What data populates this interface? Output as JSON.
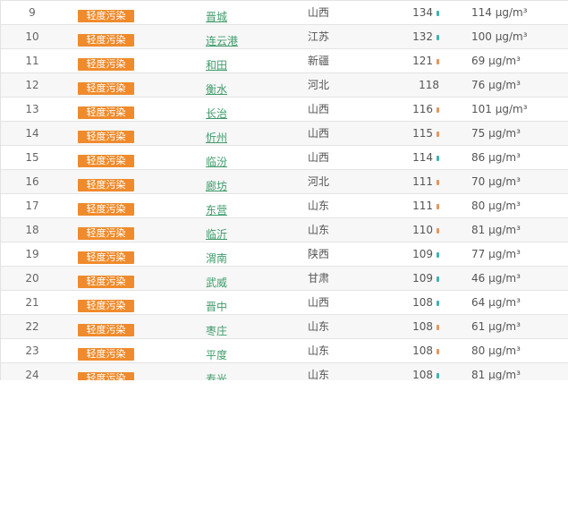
{
  "table": {
    "rows": [
      {
        "rank": "9",
        "level": "轻度污染",
        "city": "晋城",
        "city_link": true,
        "province": "山西",
        "aqi": "134",
        "trend": "down",
        "pm25": "114 μg/m³"
      },
      {
        "rank": "10",
        "level": "轻度污染",
        "city": "连云港",
        "city_link": true,
        "province": "江苏",
        "aqi": "132",
        "trend": "down",
        "pm25": "100 μg/m³"
      },
      {
        "rank": "11",
        "level": "轻度污染",
        "city": "和田",
        "city_link": true,
        "province": "新疆",
        "aqi": "121",
        "trend": "up",
        "pm25": "69 μg/m³"
      },
      {
        "rank": "12",
        "level": "轻度污染",
        "city": "衡水",
        "city_link": true,
        "province": "河北",
        "aqi": "118",
        "trend": "none",
        "pm25": "76 μg/m³"
      },
      {
        "rank": "13",
        "level": "轻度污染",
        "city": "长治",
        "city_link": true,
        "province": "山西",
        "aqi": "116",
        "trend": "up",
        "pm25": "101 μg/m³"
      },
      {
        "rank": "14",
        "level": "轻度污染",
        "city": "忻州",
        "city_link": true,
        "province": "山西",
        "aqi": "115",
        "trend": "up",
        "pm25": "75 μg/m³"
      },
      {
        "rank": "15",
        "level": "轻度污染",
        "city": "临汾",
        "city_link": true,
        "province": "山西",
        "aqi": "114",
        "trend": "down",
        "pm25": "86 μg/m³"
      },
      {
        "rank": "16",
        "level": "轻度污染",
        "city": "廊坊",
        "city_link": true,
        "province": "河北",
        "aqi": "111",
        "trend": "up",
        "pm25": "70 μg/m³"
      },
      {
        "rank": "17",
        "level": "轻度污染",
        "city": "东营",
        "city_link": true,
        "province": "山东",
        "aqi": "111",
        "trend": "up",
        "pm25": "80 μg/m³"
      },
      {
        "rank": "18",
        "level": "轻度污染",
        "city": "临沂",
        "city_link": true,
        "province": "山东",
        "aqi": "110",
        "trend": "up",
        "pm25": "81 μg/m³"
      },
      {
        "rank": "19",
        "level": "轻度污染",
        "city": "渭南",
        "city_link": false,
        "province": "陕西",
        "aqi": "109",
        "trend": "down",
        "pm25": "77 μg/m³"
      },
      {
        "rank": "20",
        "level": "轻度污染",
        "city": "武威",
        "city_link": false,
        "province": "甘肃",
        "aqi": "109",
        "trend": "down",
        "pm25": "46 μg/m³"
      },
      {
        "rank": "21",
        "level": "轻度污染",
        "city": "晋中",
        "city_link": false,
        "province": "山西",
        "aqi": "108",
        "trend": "down",
        "pm25": "64 μg/m³"
      },
      {
        "rank": "22",
        "level": "轻度污染",
        "city": "枣庄",
        "city_link": false,
        "province": "山东",
        "aqi": "108",
        "trend": "up",
        "pm25": "61 μg/m³"
      },
      {
        "rank": "23",
        "level": "轻度污染",
        "city": "平度",
        "city_link": false,
        "province": "山东",
        "aqi": "108",
        "trend": "up",
        "pm25": "80 μg/m³"
      },
      {
        "rank": "24",
        "level": "轻度污染",
        "city": "寿光",
        "city_link": false,
        "province": "山东",
        "aqi": "108",
        "trend": "down",
        "pm25": "81 μg/m³"
      }
    ]
  },
  "colors": {
    "badge": "#ef8b2c",
    "link": "#3f9b6a",
    "trend_up": "#e8955a",
    "trend_down": "#3db4b0",
    "alt_row": "#f7f7f7"
  }
}
